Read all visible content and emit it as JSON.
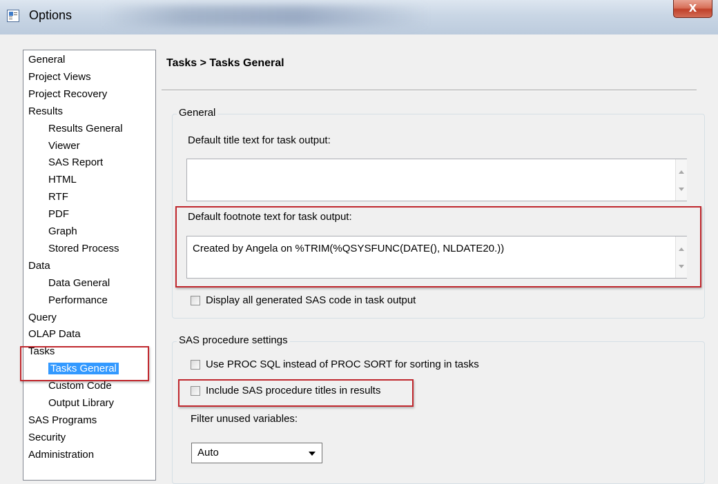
{
  "window": {
    "title": "Options",
    "close_label": "X"
  },
  "nav": {
    "items": [
      {
        "label": "General",
        "level": 0
      },
      {
        "label": "Project Views",
        "level": 0
      },
      {
        "label": "Project Recovery",
        "level": 0
      },
      {
        "label": "Results",
        "level": 0
      },
      {
        "label": "Results General",
        "level": 1
      },
      {
        "label": "Viewer",
        "level": 1
      },
      {
        "label": "SAS Report",
        "level": 1
      },
      {
        "label": "HTML",
        "level": 1
      },
      {
        "label": "RTF",
        "level": 1
      },
      {
        "label": "PDF",
        "level": 1
      },
      {
        "label": "Graph",
        "level": 1
      },
      {
        "label": "Stored Process",
        "level": 1
      },
      {
        "label": "Data",
        "level": 0
      },
      {
        "label": "Data General",
        "level": 1
      },
      {
        "label": "Performance",
        "level": 1
      },
      {
        "label": "Query",
        "level": 0
      },
      {
        "label": "OLAP Data",
        "level": 0
      },
      {
        "label": "Tasks",
        "level": 0
      },
      {
        "label": "Tasks General",
        "level": 1,
        "selected": true
      },
      {
        "label": "Custom Code",
        "level": 1
      },
      {
        "label": "Output Library",
        "level": 1
      },
      {
        "label": "SAS Programs",
        "level": 0
      },
      {
        "label": "Security",
        "level": 0
      },
      {
        "label": "Administration",
        "level": 0
      }
    ]
  },
  "page": {
    "title": "Tasks > Tasks General"
  },
  "general_group": {
    "label": "General",
    "title_text_label": "Default title text for task output:",
    "title_text_value": "",
    "footnote_label": "Default footnote text for task output:",
    "footnote_value": "Created by Angela on %TRIM(%QSYSFUNC(DATE(), NLDATE20.))",
    "display_code_label": "Display all generated SAS code in task output",
    "display_code_checked": false
  },
  "proc_group": {
    "label": "SAS procedure settings",
    "proc_sql_label": "Use PROC SQL instead of PROC SORT for sorting in tasks",
    "proc_sql_checked": false,
    "include_titles_label": "Include SAS procedure titles in results",
    "include_titles_checked": false,
    "filter_label": "Filter unused variables:",
    "filter_value": "Auto"
  },
  "colors": {
    "highlight": "#c0272d",
    "selection": "#3399ff"
  }
}
